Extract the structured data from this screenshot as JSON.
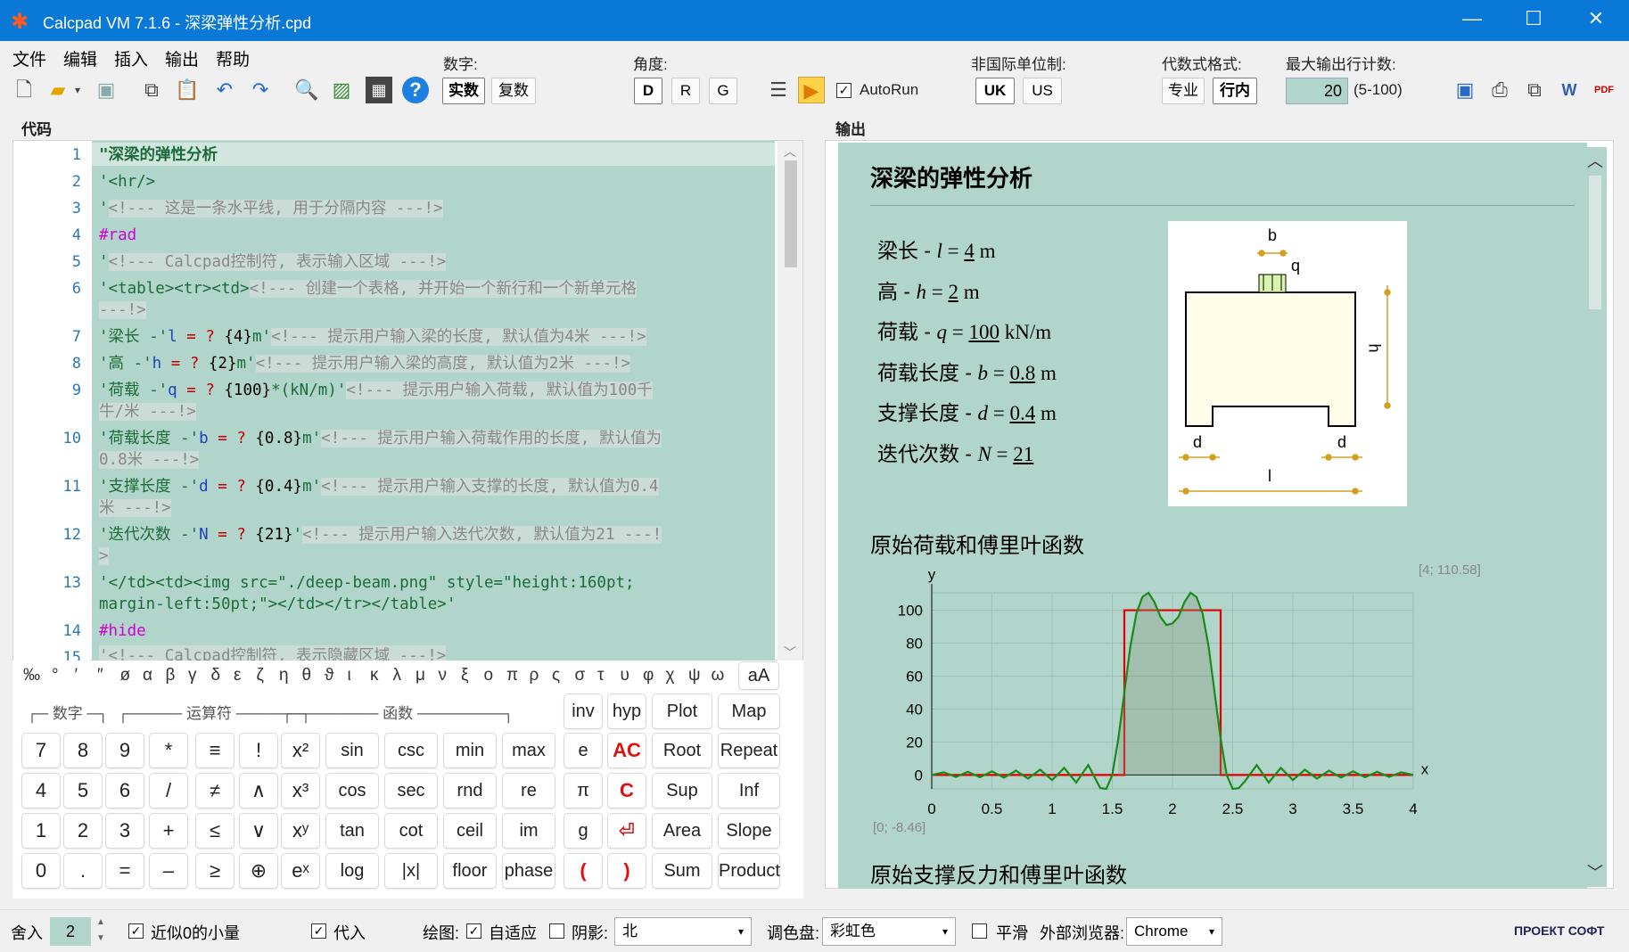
{
  "window": {
    "title": "Calcpad VM 7.1.6 - 深梁弹性分析.cpd"
  },
  "menu": [
    "文件",
    "编辑",
    "插入",
    "输出",
    "帮助"
  ],
  "toolbar": {
    "number_label": "数字:",
    "real": "实数",
    "complex": "复数",
    "angle_label": "角度:",
    "angle_d": "D",
    "angle_r": "R",
    "angle_g": "G",
    "autorun": "AutoRun",
    "units_label": "非国际单位制:",
    "uk": "UK",
    "us": "US",
    "format_label": "代数式格式:",
    "pro": "专业",
    "inline": "行内",
    "maxlines_label": "最大输出行计数:",
    "maxlines_value": "20",
    "maxlines_range": "(5-100)"
  },
  "code": {
    "title": "代码",
    "line_numbers": [
      "1",
      "2",
      "3",
      "4",
      "5",
      "6",
      "7",
      "8",
      "9",
      "10",
      "11",
      "12",
      "13",
      "14",
      "15"
    ],
    "lines": {
      "l1": "\"深梁的弹性分析",
      "l2": "'<hr/>",
      "l3a": "'",
      "l3c": "<!--- 这是一条水平线, 用于分隔内容 ---!>",
      "l4": "#rad",
      "l5a": "'",
      "l5c": "<!--- Calcpad控制符, 表示输入区域 ---!>",
      "l6a": "'<table><tr><td>",
      "l6c": "<!--- 创建一个表格, 并开始一个新行和一个新单元格",
      "l6d": "---!>",
      "l7a": "'梁长 -'",
      "l7v": "l",
      "l7b": " = ",
      "l7q": "?",
      "l7n": " {4}",
      "l7u": "m'",
      "l7c": "<!--- 提示用户输入梁的长度, 默认值为4米 ---!>",
      "l8a": "'高 -'",
      "l8v": "h",
      "l8b": " = ",
      "l8q": "?",
      "l8n": " {2}",
      "l8u": "m'",
      "l8c": "<!--- 提示用户输入梁的高度, 默认值为2米 ---!>",
      "l9a": "'荷载 -'",
      "l9v": "q",
      "l9b": " = ",
      "l9q": "?",
      "l9n": " {100}",
      "l9u": "*(kN/m)'",
      "l9c": "<!--- 提示用户输入荷载, 默认值为100千",
      "l9d": "牛/米 ---!>",
      "l10a": "'荷载长度 -'",
      "l10v": "b",
      "l10b": " = ",
      "l10q": "?",
      "l10n": " {0.8}",
      "l10u": "m'",
      "l10c": "<!--- 提示用户输入荷载作用的长度, 默认值为",
      "l10d": "0.8米 ---!>",
      "l11a": "'支撑长度 -'",
      "l11v": "d",
      "l11b": " = ",
      "l11q": "?",
      "l11n": " {0.4}",
      "l11u": "m'",
      "l11c": "<!--- 提示用户输入支撑的长度, 默认值为0.4",
      "l11d": "米 ---!>",
      "l12a": "'迭代次数 -'",
      "l12v": "N",
      "l12b": " = ",
      "l12q": "?",
      "l12n": " {21}",
      "l12u": "'",
      "l12c": "<!--- 提示用户输入迭代次数, 默认值为21 ---!",
      "l12d": ">",
      "l13a": "'</td><td><img src=\"./deep-beam.png\" style=\"height:160pt;",
      "l13b": "margin-left:50pt;\"></td></tr></table>'",
      "l14": "#hide",
      "l15": "'<!--- Calcpad控制符, 表示隐藏区域 ---!>"
    }
  },
  "symbols": [
    "‰",
    "°",
    "′",
    "″",
    "ø",
    "α",
    "β",
    "γ",
    "δ",
    "ε",
    "ζ",
    "η",
    "θ",
    "ϑ",
    "ι",
    "κ",
    "λ",
    "μ",
    "ν",
    "ξ",
    "ο",
    "π",
    "ρ",
    "ς",
    "σ",
    "τ",
    "υ",
    "φ",
    "χ",
    "ψ",
    "ω"
  ],
  "symbols_toggle": "aA",
  "keypad": {
    "groups": [
      "数字",
      "运算符",
      "函数"
    ],
    "top": [
      "inv",
      "hyp",
      "Plot",
      "Map"
    ],
    "rows": [
      [
        "7",
        "8",
        "9",
        "*",
        "≡",
        "!",
        "x²",
        "sin",
        "csc",
        "min",
        "max",
        "e",
        "AC",
        "Root",
        "Repeat"
      ],
      [
        "4",
        "5",
        "6",
        "/",
        "≠",
        "∧",
        "x³",
        "cos",
        "sec",
        "rnd",
        "re",
        "π",
        "C",
        "Sup",
        "Inf"
      ],
      [
        "1",
        "2",
        "3",
        "+",
        "≤",
        "∨",
        "xʸ",
        "tan",
        "cot",
        "ceil",
        "im",
        "g",
        "⏎",
        "Area",
        "Slope"
      ],
      [
        "0",
        ".",
        "=",
        "–",
        "≥",
        "⊕",
        "eˣ",
        "log",
        "|x|",
        "floor",
        "phase",
        "(",
        ")",
        "Sum",
        "Product"
      ]
    ]
  },
  "output": {
    "title": "输出",
    "heading": "深梁的弹性分析",
    "params": [
      {
        "label": "梁长 - ",
        "sym": "l",
        "eq": " = ",
        "val": "4",
        "unit": " m"
      },
      {
        "label": "高 - ",
        "sym": "h",
        "eq": " = ",
        "val": "2",
        "unit": " m"
      },
      {
        "label": "荷载 - ",
        "sym": "q",
        "eq": " = ",
        "val": "100",
        "unit": " kN/m"
      },
      {
        "label": "荷载长度 - ",
        "sym": "b",
        "eq": " = ",
        "val": "0.8",
        "unit": " m"
      },
      {
        "label": "支撑长度 - ",
        "sym": "d",
        "eq": " = ",
        "val": "0.4",
        "unit": " m"
      },
      {
        "label": "迭代次数 - ",
        "sym": "N",
        "eq": " = ",
        "val": "21",
        "unit": ""
      }
    ],
    "diagram": {
      "b": "b",
      "q": "q",
      "h": "h",
      "d1": "d",
      "d2": "d",
      "l": "l"
    },
    "section1": "原始荷载和傅里叶函数",
    "section2": "原始支撑反力和傅里叶函数",
    "corner_max": "[4; 110.58]",
    "corner_min": "[0; -8.46]"
  },
  "chart_data": {
    "type": "line",
    "xlabel": "x",
    "ylabel": "y",
    "xlim": [
      0,
      4
    ],
    "ylim": [
      -8.46,
      110.58
    ],
    "xticks": [
      "0",
      "0.5",
      "1",
      "1.5",
      "2",
      "2.5",
      "3",
      "3.5",
      "4"
    ],
    "yticks": [
      "0",
      "20",
      "40",
      "60",
      "80",
      "100"
    ],
    "grid": true,
    "series": [
      {
        "color": "#e00000",
        "x": [
          0,
          1.6,
          1.6,
          2.4,
          2.4,
          4
        ],
        "y": [
          0,
          0,
          100,
          100,
          0,
          0
        ]
      },
      {
        "color": "#1a8a1a",
        "x": [
          0,
          0.1,
          0.2,
          0.3,
          0.4,
          0.5,
          0.6,
          0.7,
          0.8,
          0.9,
          1.0,
          1.1,
          1.2,
          1.3,
          1.4,
          1.45,
          1.5,
          1.55,
          1.6,
          1.65,
          1.7,
          1.75,
          1.8,
          1.85,
          1.9,
          1.95,
          2.0,
          2.05,
          2.1,
          2.15,
          2.2,
          2.25,
          2.3,
          2.35,
          2.4,
          2.45,
          2.5,
          2.55,
          2.6,
          2.7,
          2.8,
          2.9,
          3.0,
          3.1,
          3.2,
          3.3,
          3.4,
          3.5,
          3.6,
          3.7,
          3.8,
          3.9,
          4.0
        ],
        "y": [
          0,
          1.6,
          -1.2,
          1.9,
          -1.4,
          2.2,
          -1.6,
          2.6,
          -2.2,
          3.2,
          -3.1,
          4.3,
          -4.6,
          6.0,
          -8.0,
          -8.46,
          0,
          22,
          50,
          78,
          98,
          108,
          110.58,
          105,
          96,
          91,
          92,
          96,
          105,
          110.58,
          108,
          98,
          78,
          50,
          22,
          0,
          -8.46,
          -8.0,
          -4,
          6.0,
          -4.6,
          4.3,
          -3.1,
          3.2,
          -2.2,
          2.6,
          -1.6,
          2.2,
          -1.4,
          1.9,
          -1.2,
          1.6,
          0
        ]
      }
    ]
  },
  "status": {
    "round_label": "舍入",
    "round_value": "2",
    "approx_zero": "近似0的小量",
    "substitute": "代入",
    "plot_label": "绘图:",
    "adaptive": "自适应",
    "shadow": "阴影:",
    "shadow_value": "北",
    "palette_label": "调色盘:",
    "palette_value": "彩虹色",
    "smooth": "平滑",
    "browser_label": "外部浏览器:",
    "browser_value": "Chrome",
    "brand": "ПРОЕКТ СОФТ"
  }
}
